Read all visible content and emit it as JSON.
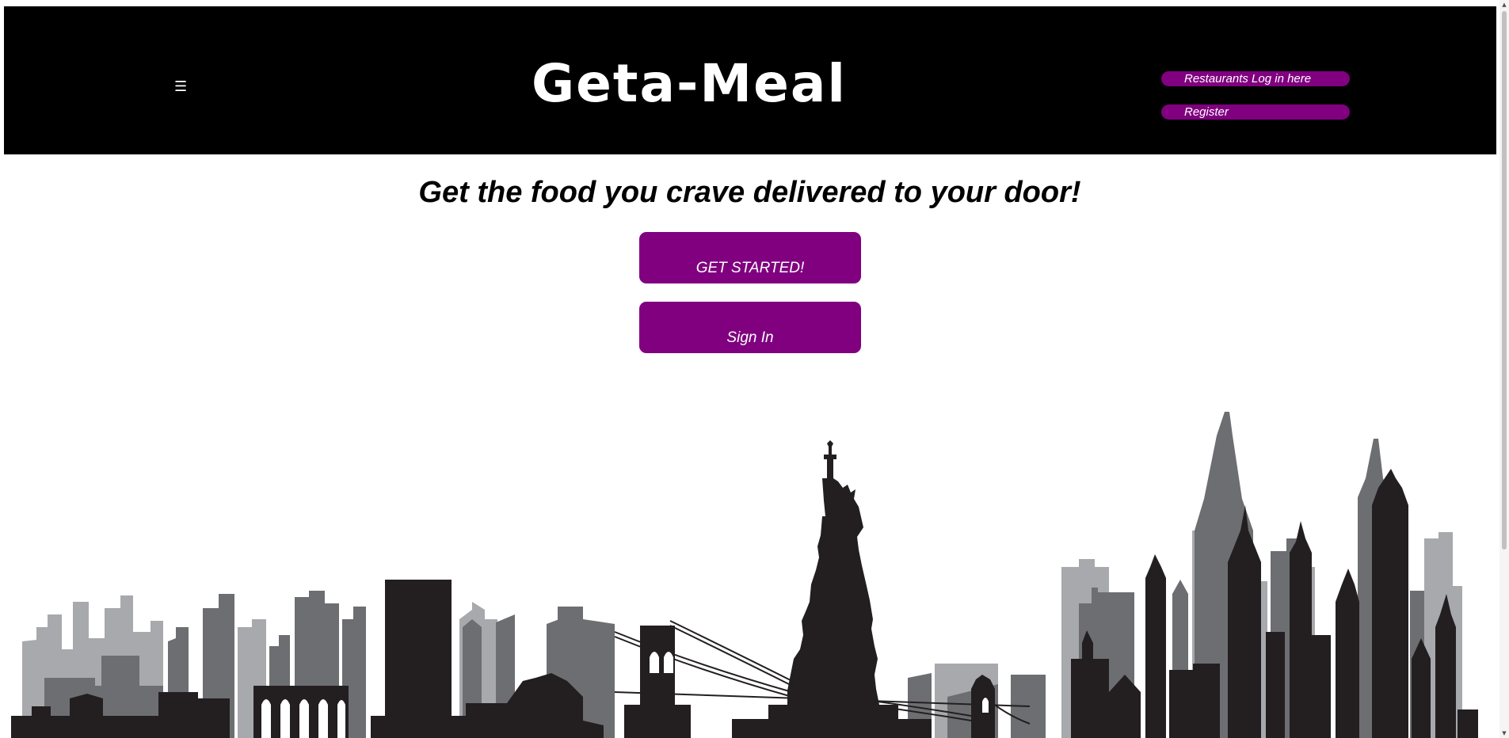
{
  "header": {
    "menu_icon": "☰",
    "logo": "Geta-Meal",
    "restaurant_login_label": "Restaurants Log in here",
    "register_label": "Register"
  },
  "main": {
    "tagline": "Get the food you crave delivered to your door!",
    "get_started_label": "GET STARTED!",
    "sign_in_label": "Sign In"
  },
  "colors": {
    "header_bg": "#000000",
    "accent": "#800080",
    "text_on_accent": "#ffffff",
    "skyline_dark": "#231f20",
    "skyline_mid": "#6d6e71",
    "skyline_light": "#a7a9ac"
  },
  "icons": {
    "menu": "hamburger-menu-icon",
    "illustration": "city-skyline-illustration"
  },
  "scrollbar": {
    "up_arrow": "▲",
    "down_arrow": "▼"
  }
}
